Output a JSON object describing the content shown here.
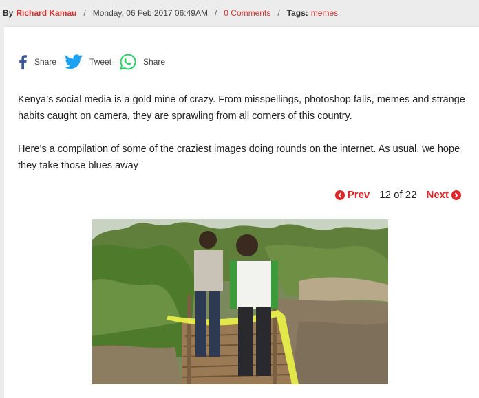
{
  "meta": {
    "by": "By",
    "author": "Richard Kamau",
    "sep": "/",
    "date": "Monday, 06 Feb 2017 06:49AM",
    "comments": "0 Comments",
    "tags_label": "Tags:",
    "tag": "memes"
  },
  "share": {
    "facebook_label": "Share",
    "twitter_label": "Tweet",
    "whatsapp_label": "Share"
  },
  "article": {
    "paragraph1": "Kenya’s social media is a gold mine of crazy. From misspellings, photoshop fails, memes and strange habits caught on camera, they are sprawling from all corners of this country.",
    "paragraph2": "Here’s a compilation of some of the craziest images doing rounds on the internet. As usual, we hope they take those blues away"
  },
  "pager": {
    "prev_label": "Prev",
    "count": "12 of 22",
    "next_label": "Next"
  },
  "colors": {
    "accent": "#e0262b",
    "link": "#d9302c",
    "facebook": "#3b5998",
    "twitter": "#1da1f2",
    "whatsapp": "#25d366"
  }
}
